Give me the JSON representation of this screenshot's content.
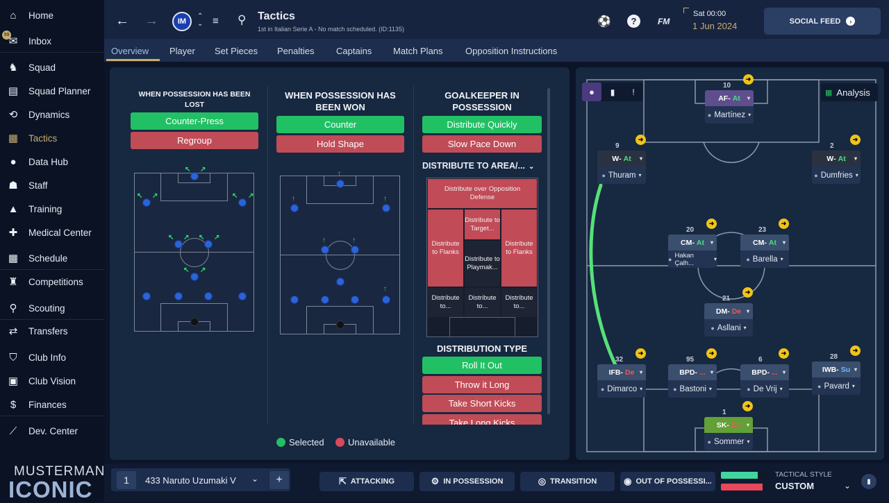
{
  "sidebar": {
    "items": [
      {
        "label": "Home",
        "icon": "home-icon",
        "glyph": "⌂"
      },
      {
        "label": "Inbox",
        "icon": "inbox-icon",
        "glyph": "✉"
      },
      {
        "label": "Squad",
        "icon": "shirt-icon",
        "glyph": "♞"
      },
      {
        "label": "Squad Planner",
        "icon": "clipboard-icon",
        "glyph": "▤"
      },
      {
        "label": "Dynamics",
        "icon": "dynamics-icon",
        "glyph": "⟲"
      },
      {
        "label": "Tactics",
        "icon": "tactics-board-icon",
        "glyph": "▦"
      },
      {
        "label": "Data Hub",
        "icon": "data-hub-icon",
        "glyph": "●"
      },
      {
        "label": "Staff",
        "icon": "staff-icon",
        "glyph": "☗"
      },
      {
        "label": "Training",
        "icon": "training-cone-icon",
        "glyph": "▲"
      },
      {
        "label": "Medical Center",
        "icon": "medical-icon",
        "glyph": "✚"
      },
      {
        "label": "Schedule",
        "icon": "calendar-icon",
        "glyph": "▦"
      },
      {
        "label": "Competitions",
        "icon": "trophy-icon",
        "glyph": "♜"
      },
      {
        "label": "Scouting",
        "icon": "scouting-icon",
        "glyph": "⚲"
      },
      {
        "label": "Transfers",
        "icon": "transfers-icon",
        "glyph": "⇄"
      },
      {
        "label": "Club Info",
        "icon": "shield-icon",
        "glyph": "⛉"
      },
      {
        "label": "Club Vision",
        "icon": "briefcase-icon",
        "glyph": "▣"
      },
      {
        "label": "Finances",
        "icon": "finances-icon",
        "glyph": "$"
      },
      {
        "label": "Dev. Center",
        "icon": "dev-center-icon",
        "glyph": "⟋"
      }
    ],
    "inbox_badge": "99",
    "brand": {
      "line1": "MUSTERMANN",
      "line2": "ICONIC"
    }
  },
  "header": {
    "title": "Tactics",
    "subtitle": "1st in Italian Serie A - No match scheduled. (ID:1135)",
    "fm": "FM",
    "day_time": "Sat 00:00",
    "date": "1 Jun 2024",
    "social_feed": "SOCIAL FEED"
  },
  "tabs": [
    "Overview",
    "Player",
    "Set Pieces",
    "Penalties",
    "Captains",
    "Match Plans",
    "Opposition Instructions"
  ],
  "lost": {
    "title": "WHEN POSSESSION HAS BEEN LOST",
    "opt1": "Counter-Press",
    "opt2": "Regroup"
  },
  "won": {
    "title": "WHEN POSSESSION HAS BEEN WON",
    "opt1": "Counter",
    "opt2": "Hold Shape"
  },
  "gk": {
    "title": "GOALKEEPER IN POSSESSION",
    "opt1": "Distribute Quickly",
    "opt2": "Slow Pace Down",
    "area_label": "DISTRIBUTE TO AREA/...",
    "zones": {
      "top": "Distribute over Opposition Defense",
      "target": "Distribute to Target...",
      "flank_l": "Distribute to Flanks",
      "flank_r": "Distribute to Flanks",
      "play": "Distribute to Playmak...",
      "b1": "Distribute to...",
      "b2": "Distribute to...",
      "b3": "Distribute to..."
    },
    "dist_title": "DISTRIBUTION TYPE",
    "d1": "Roll It Out",
    "d2": "Throw it Long",
    "d3": "Take Short Kicks",
    "d4": "Take Long Kicks"
  },
  "legend": {
    "selected": "Selected",
    "unavailable": "Unavailable"
  },
  "analysis": "Analysis",
  "players": [
    {
      "id": "af",
      "role": "AF",
      "duty": "At",
      "duty_type": "a",
      "name": "Martínez",
      "num": "10"
    },
    {
      "id": "wl",
      "role": "W",
      "duty": "At",
      "duty_type": "a",
      "name": "Thuram",
      "num": "9"
    },
    {
      "id": "wr",
      "role": "W",
      "duty": "At",
      "duty_type": "a",
      "name": "Dumfries",
      "num": "2"
    },
    {
      "id": "cml",
      "role": "CM",
      "duty": "At",
      "duty_type": "a",
      "name": "Hakan Çalh...",
      "num": "20"
    },
    {
      "id": "cmr",
      "role": "CM",
      "duty": "At",
      "duty_type": "a",
      "name": "Barella",
      "num": "23"
    },
    {
      "id": "dm",
      "role": "DM",
      "duty": "De",
      "duty_type": "d",
      "name": "Asllani",
      "num": "21"
    },
    {
      "id": "ifb",
      "role": "IFB",
      "duty": "De",
      "duty_type": "d",
      "name": "Dimarco",
      "num": "32"
    },
    {
      "id": "bpdl",
      "role": "BPD",
      "duty": "...",
      "duty_type": "d",
      "name": "Bastoni",
      "num": "95"
    },
    {
      "id": "bpdr",
      "role": "BPD",
      "duty": "...",
      "duty_type": "d",
      "name": "De Vrij",
      "num": "6"
    },
    {
      "id": "iwb",
      "role": "IWB",
      "duty": "Su",
      "duty_type": "s",
      "name": "Pavard",
      "num": "28"
    },
    {
      "id": "sk",
      "role": "SK",
      "duty": "De",
      "duty_type": "d",
      "name": "Sommer",
      "num": "1"
    }
  ],
  "bottom": {
    "slot": "1",
    "tactic_name": "433 Naruto Uzumaki V",
    "attacking": "ATTACKING",
    "in_possession": "IN POSSESSION",
    "transition": "TRANSITION",
    "out_of_possession": "OUT OF POSSESSI...",
    "style_label": "TACTICAL STYLE",
    "style_value": "CUSTOM"
  },
  "colors": {
    "accent": "#c9ad6e",
    "selected": "#22c064",
    "unavailable": "#c04c57"
  }
}
